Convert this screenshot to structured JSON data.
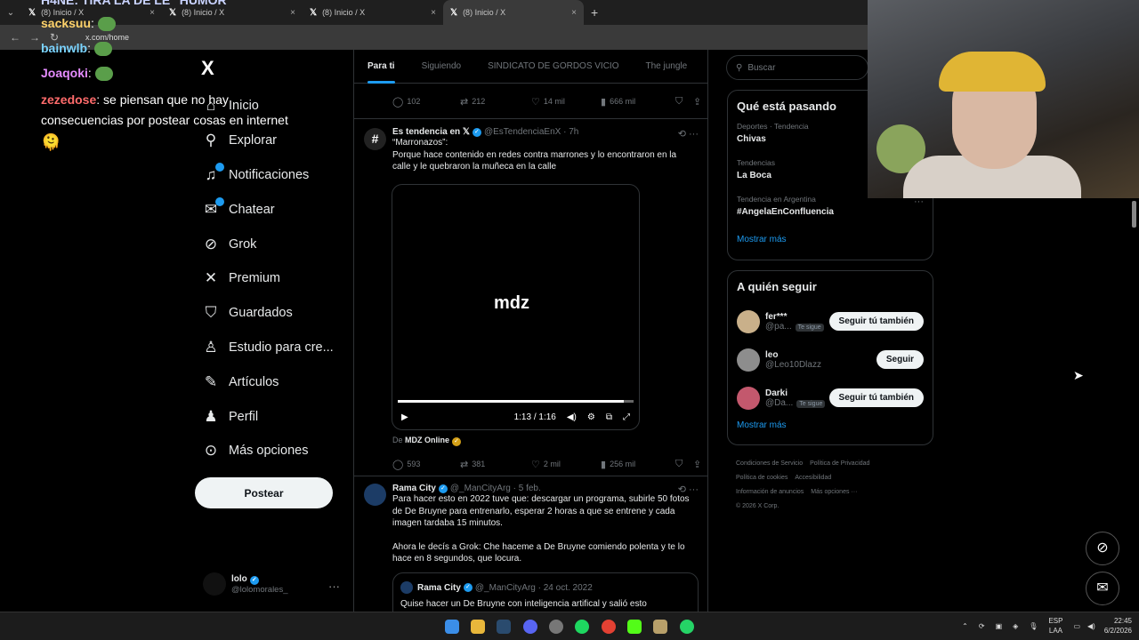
{
  "browser": {
    "tabs": [
      {
        "label": "(8) Inicio / X",
        "close": "×"
      },
      {
        "label": "(8) Inicio / X",
        "close": "×"
      },
      {
        "label": "(8) Inicio / X",
        "close": "×"
      },
      {
        "label": "(8) Inicio / X",
        "close": "×"
      }
    ],
    "new_tab": "+",
    "url": "x.com/home"
  },
  "stream_chat": {
    "header": "H4NE: TIRA LA DE LE \"HUMOR\"",
    "lines": [
      {
        "user": "sacksuu",
        "text": ":"
      },
      {
        "user": "bainwlb",
        "text": ":"
      },
      {
        "user": "Joaqoki",
        "text": ":"
      },
      {
        "user": "zezedose",
        "text": ": se piensan que no hay"
      },
      {
        "user": "",
        "text": "consecuencias por postear cosas en internet"
      }
    ]
  },
  "sidebar": {
    "logo": "X",
    "items": [
      {
        "label": "Inicio",
        "icon": "home-icon"
      },
      {
        "label": "Explorar",
        "icon": "search-icon"
      },
      {
        "label": "Notificaciones",
        "icon": "bell-icon"
      },
      {
        "label": "Chatear",
        "icon": "mail-icon"
      },
      {
        "label": "Grok",
        "icon": "grok-icon"
      },
      {
        "label": "Premium",
        "icon": "x-icon"
      },
      {
        "label": "Guardados",
        "icon": "bookmark-icon"
      },
      {
        "label": "Estudio para cre...",
        "icon": "studio-icon"
      },
      {
        "label": "Artículos",
        "icon": "article-icon"
      },
      {
        "label": "Perfil",
        "icon": "person-icon"
      },
      {
        "label": "Más opciones",
        "icon": "more-icon"
      }
    ],
    "post_button": "Postear",
    "account": {
      "name": "lolo",
      "handle": "@lolomorales_",
      "more": "···"
    }
  },
  "main": {
    "tabs": [
      "Para ti",
      "Siguiendo",
      "SINDICATO DE GORDOS VICIO",
      "The jungle"
    ],
    "top_actions": {
      "replies": "102",
      "reposts": "212",
      "likes": "14 mil",
      "views": "666 mil"
    },
    "post1": {
      "name": "Es tendencia en 𝕏",
      "handle": "@EsTendenciaEnX",
      "time": "· 7h",
      "text1": "“Marronazos”:",
      "text2": "Porque hace contenido en redes contra marrones y lo encontraron en la calle y le quebraron la muñeca en la calle",
      "video_logo": "mdz",
      "video_time": "1:13 / 1:16",
      "video_progress": 0.96,
      "source_prefix": "De",
      "source": "MDZ Online",
      "actions": {
        "replies": "593",
        "reposts": "381",
        "likes": "2 mil",
        "views": "256 mil"
      }
    },
    "post2": {
      "name": "Rama City",
      "handle": "@_ManCityArg",
      "time": "· 5 feb.",
      "text1": "Para hacer esto en 2022 tuve que: descargar un programa, subirle 50 fotos de De Bruyne para entrenarlo, esperar 2 horas a que se entrene y cada imagen tardaba 15 minutos.",
      "text2": "Ahora le decís a Grok: Che haceme a De Bruyne comiendo polenta y te lo hace en 8 segundos, que locura.",
      "quote": {
        "name": "Rama City",
        "handle": "@_ManCityArg",
        "time": "· 24 oct. 2022",
        "text": "Quise hacer un De Bruyne con inteligencia artifical y salió esto"
      }
    }
  },
  "right": {
    "search_placeholder": "Buscar",
    "trending": {
      "title": "Qué está pasando",
      "items": [
        {
          "sub": "Deportes · Tendencia",
          "name": "Chivas"
        },
        {
          "sub": "Tendencias",
          "name": "La Boca"
        },
        {
          "sub": "Tendencia en Argentina",
          "name": "#AngelaEnConfluencia"
        }
      ],
      "show_more": "Mostrar más"
    },
    "who_to_follow": {
      "title": "A quién seguir",
      "items": [
        {
          "name": "fer***",
          "handle": "@pa...",
          "follows_you": "Te sigue",
          "button": "Seguir tú también"
        },
        {
          "name": "leo",
          "handle": "@Leo10Dlazz",
          "follows_you": "",
          "button": "Seguir"
        },
        {
          "name": "Darki",
          "handle": "@Da...",
          "follows_you": "Te sigue",
          "button": "Seguir tú también"
        }
      ],
      "show_more": "Mostrar más"
    },
    "footer": [
      "Condiciones de Servicio",
      "Política de Privacidad",
      "Política de cookies",
      "Accesibilidad",
      "Información de anuncios",
      "Más opciones ···",
      "© 2026 X Corp."
    ]
  },
  "taskbar": {
    "lang1": "ESP",
    "lang2": "LAA",
    "time": "22:45",
    "date": "6/2/2026"
  }
}
